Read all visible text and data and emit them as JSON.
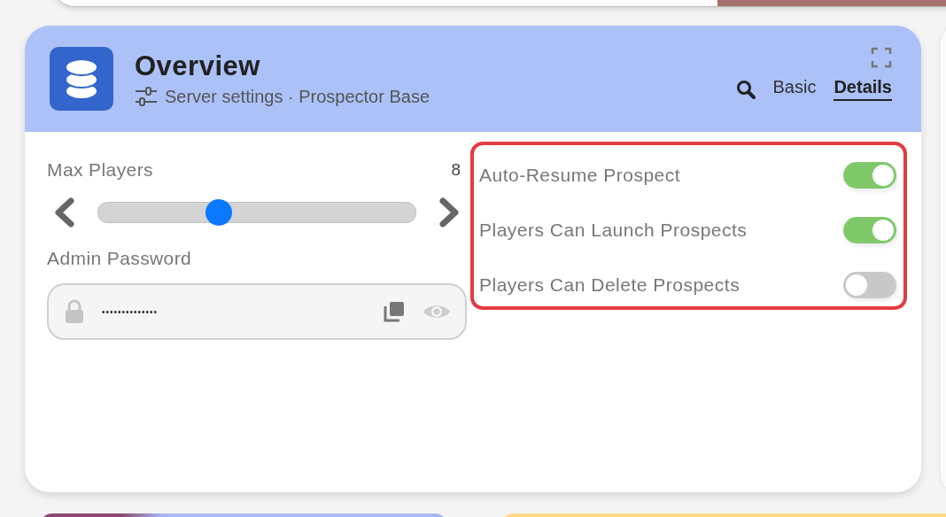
{
  "header": {
    "title": "Overview",
    "subtitle": "Server settings · Prospector Base"
  },
  "tabs": [
    {
      "label": "Basic",
      "selected": false
    },
    {
      "label": "Details",
      "selected": true
    }
  ],
  "max_players": {
    "label": "Max Players",
    "reading": "8",
    "level": 0.38
  },
  "admin_password": {
    "label": "Admin Password",
    "value": "••••••••••••••"
  },
  "toggles": {
    "highlighted": true,
    "items": [
      {
        "label": "Auto-Resume Prospect",
        "on": true
      },
      {
        "label": "Players Can Launch Prospects",
        "on": true
      },
      {
        "label": "Players Can Delete Prospects",
        "on": false
      }
    ]
  }
}
